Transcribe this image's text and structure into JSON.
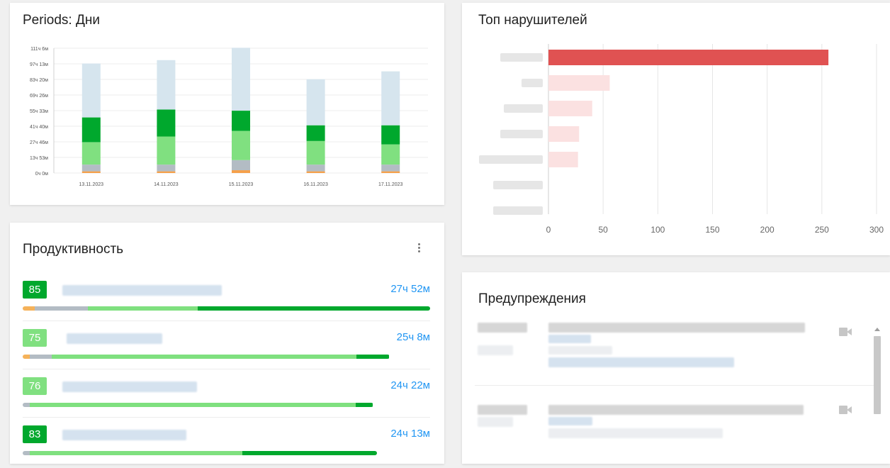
{
  "periods": {
    "title": "Periods: Дни",
    "chart_data": {
      "type": "bar",
      "stacked": true,
      "categories": [
        "13.11.2023",
        "14.11.2023",
        "15.11.2023",
        "16.11.2023",
        "17.11.2023"
      ],
      "y_ticks": [
        "111ч 6м",
        "97ч 13м",
        "83ч 20м",
        "69ч 26м",
        "55ч 33м",
        "41ч 40м",
        "27ч 46м",
        "13ч 53м",
        "0ч 0м"
      ],
      "ylim": [
        0,
        111.1
      ],
      "series": [
        {
          "color": "#f5a04a",
          "values": [
            1.5,
            1.5,
            2.5,
            1.5,
            1.5
          ]
        },
        {
          "color": "#b3bcc4",
          "values": [
            6,
            6,
            9,
            6,
            6
          ]
        },
        {
          "color": "#80e080",
          "values": [
            20,
            25,
            26,
            21,
            18
          ]
        },
        {
          "color": "#00a82d",
          "values": [
            22,
            24,
            18,
            14,
            17
          ]
        },
        {
          "color": "#d6e5ee",
          "values": [
            48,
            44,
            56,
            41,
            48
          ]
        }
      ]
    }
  },
  "top": {
    "title": "Топ нарушителей",
    "chart_data": {
      "type": "bar",
      "orientation": "horizontal",
      "values": [
        256,
        56,
        40,
        28,
        27,
        0,
        0
      ],
      "xlim": [
        0,
        300
      ],
      "x_ticks": [
        "0",
        "50",
        "100",
        "150",
        "200",
        "250",
        "300"
      ],
      "colors": [
        "#e05252",
        "#fbe1e1",
        "#fbe1e1",
        "#fbe1e1",
        "#fbe1e1",
        "#fbe1e1",
        "#fbe1e1"
      ]
    }
  },
  "productivity": {
    "title": "Продуктивность",
    "menu_icon": "more-vert-icon",
    "items": [
      {
        "score": "85",
        "badge_color": "#00a82d",
        "time": "27ч 52м",
        "segments": [
          {
            "color": "#f5b25a",
            "pct": 3
          },
          {
            "color": "#b3bcc4",
            "pct": 13
          },
          {
            "color": "#7fe07f",
            "pct": 27
          },
          {
            "color": "#00a82d",
            "pct": 57
          }
        ],
        "bar_pct": 100
      },
      {
        "score": "75",
        "badge_color": "#80e080",
        "time": "25ч 8м",
        "segments": [
          {
            "color": "#f5b25a",
            "pct": 2
          },
          {
            "color": "#b3bcc4",
            "pct": 6
          },
          {
            "color": "#7fe07f",
            "pct": 83
          },
          {
            "color": "#00a82d",
            "pct": 9
          }
        ],
        "bar_pct": 90
      },
      {
        "score": "76",
        "badge_color": "#80e080",
        "time": "24ч 22м",
        "segments": [
          {
            "color": "#b3bcc4",
            "pct": 2
          },
          {
            "color": "#7fe07f",
            "pct": 93
          },
          {
            "color": "#00a82d",
            "pct": 5
          }
        ],
        "bar_pct": 86
      },
      {
        "score": "83",
        "badge_color": "#00a82d",
        "time": "24ч 13м",
        "segments": [
          {
            "color": "#b3bcc4",
            "pct": 2
          },
          {
            "color": "#7fe07f",
            "pct": 60
          },
          {
            "color": "#00a82d",
            "pct": 38
          }
        ],
        "bar_pct": 87
      }
    ]
  },
  "warnings": {
    "title": "Предупреждения",
    "items": [
      {
        "icon": "video-camera-icon"
      },
      {
        "icon": "video-camera-icon"
      }
    ]
  }
}
